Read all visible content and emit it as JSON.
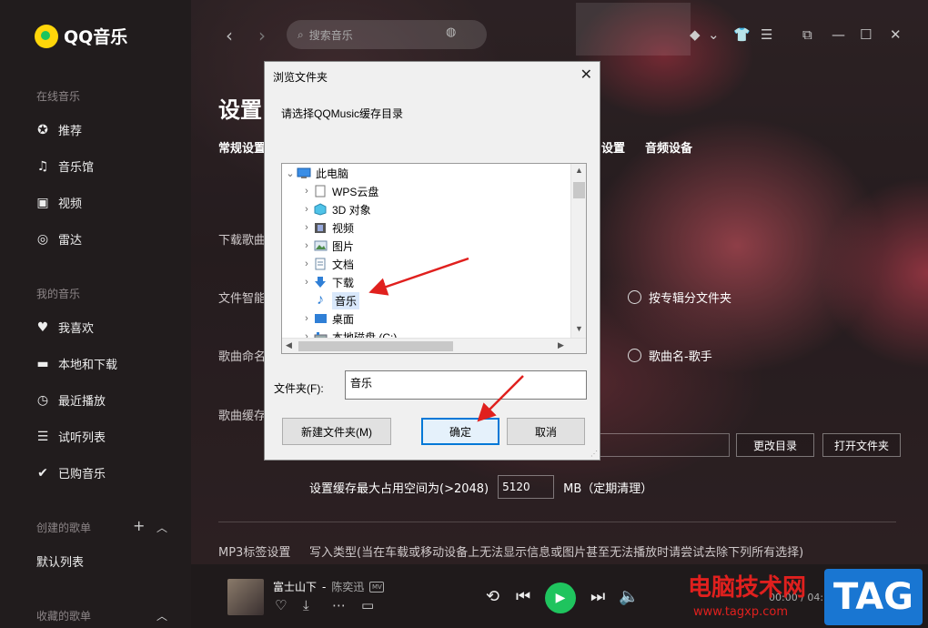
{
  "app": {
    "name": "QQ音乐"
  },
  "sidebar": {
    "online_title": "在线音乐",
    "online_items": [
      {
        "label": "推荐",
        "icon": "star-icon"
      },
      {
        "label": "音乐馆",
        "icon": "music-note-icon"
      },
      {
        "label": "视频",
        "icon": "video-icon"
      },
      {
        "label": "雷达",
        "icon": "radar-icon"
      }
    ],
    "my_title": "我的音乐",
    "my_items": [
      {
        "label": "我喜欢",
        "icon": "heart-icon"
      },
      {
        "label": "本地和下载",
        "icon": "monitor-icon"
      },
      {
        "label": "最近播放",
        "icon": "clock-icon"
      },
      {
        "label": "试听列表",
        "icon": "list-icon"
      },
      {
        "label": "已购音乐",
        "icon": "check-circle-icon"
      }
    ],
    "created_title": "创建的歌单",
    "created_items": [
      "默认列表"
    ],
    "collected_title": "收藏的歌单"
  },
  "topbar": {
    "search_placeholder": "搜索音乐"
  },
  "settings": {
    "title": "设置",
    "tab_general": "常规设置",
    "tab_partial": "设置",
    "tab_audio": "音频设备",
    "row_download_song": "下载歌曲",
    "row_smart_folder": "文件智能",
    "row_song_naming": "歌曲命名",
    "row_cache": "歌曲缓存",
    "radio_album_folder": "按专辑分文件夹",
    "radio_song_artist": "歌曲名-歌手",
    "btn_change_dir": "更改目录",
    "btn_open_folder": "打开文件夹",
    "cache_label": "设置缓存最大占用空间为(>2048)",
    "cache_value": "5120",
    "cache_unit": "MB（定期清理）",
    "mp3_label": "MP3标签设置",
    "mp3_desc": "写入类型(当在车载或移动设备上无法显示信息或图片甚至无法播放时请尝试去除下列所有选择)"
  },
  "player": {
    "song": "富士山下",
    "artist": "陈奕迅",
    "mv": "MV",
    "time": "00:00 / 04:1"
  },
  "dialog": {
    "title": "浏览文件夹",
    "close": "✕",
    "prompt": "请选择QQMusic缓存目录",
    "tree": [
      {
        "label": "此电脑",
        "icon": "computer-icon"
      },
      {
        "label": "WPS云盘",
        "icon": "document-icon"
      },
      {
        "label": "3D 对象",
        "icon": "cube-icon"
      },
      {
        "label": "视频",
        "icon": "film-icon"
      },
      {
        "label": "图片",
        "icon": "picture-icon"
      },
      {
        "label": "文档",
        "icon": "doc-icon"
      },
      {
        "label": "下载",
        "icon": "download-arrow-icon"
      },
      {
        "label": "音乐",
        "icon": "music-note-icon"
      },
      {
        "label": "桌面",
        "icon": "desktop-icon"
      },
      {
        "label": "本地磁盘 (C:)",
        "icon": "drive-icon"
      }
    ],
    "folder_label": "文件夹(F):",
    "folder_value": "音乐",
    "btn_new_folder": "新建文件夹(M)",
    "btn_ok": "确定",
    "btn_cancel": "取消"
  },
  "watermark": {
    "site_name": "电脑技术网",
    "url": "www.tagxp.com",
    "tag": "TAG"
  },
  "colors": {
    "accent_green": "#1fc45e",
    "logo_yellow": "#ffd60a",
    "annotation_red": "#e0201e",
    "dialog_primary": "#0078d7"
  }
}
